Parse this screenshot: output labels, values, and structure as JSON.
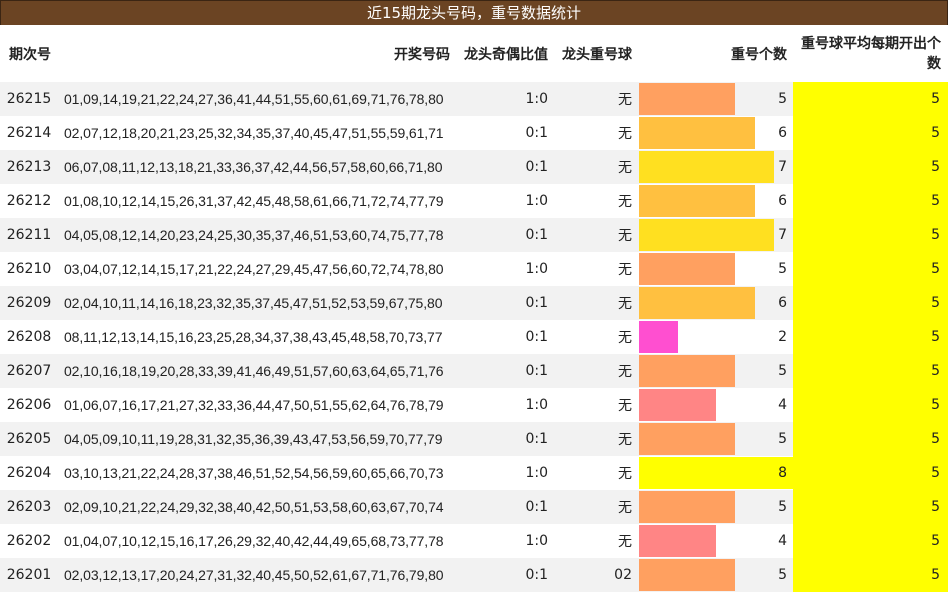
{
  "title": "近15期龙头号码，重号数据统计",
  "headers": {
    "issue": "期次号",
    "numbers": "开奖号码",
    "odd_even": "龙头奇偶比值",
    "repeat_ball": "龙头重号球",
    "repeat_count": "重号个数",
    "avg": "重号球平均每期开出个数"
  },
  "scale_max": 8,
  "colors": {
    "title_bg": "#6b4423",
    "avg_bg": "#ffff00",
    "count_2": "#ff4fd0",
    "count_4": "#ff8585",
    "count_5": "#ffa060",
    "count_6": "#ffc040",
    "count_7": "#ffe020",
    "count_8": "#ffff00"
  },
  "rows": [
    {
      "issue": "26215",
      "numbers": "01,09,14,19,21,22,24,27,36,41,44,51,55,60,61,69,71,76,78,80",
      "odd_even": "1:0",
      "repeat_ball": "无",
      "repeat_count": 5,
      "avg": "5"
    },
    {
      "issue": "26214",
      "numbers": "02,07,12,18,20,21,23,25,32,34,35,37,40,45,47,51,55,59,61,71",
      "odd_even": "0:1",
      "repeat_ball": "无",
      "repeat_count": 6,
      "avg": "5"
    },
    {
      "issue": "26213",
      "numbers": "06,07,08,11,12,13,18,21,33,36,37,42,44,56,57,58,60,66,71,80",
      "odd_even": "0:1",
      "repeat_ball": "无",
      "repeat_count": 7,
      "avg": "5"
    },
    {
      "issue": "26212",
      "numbers": "01,08,10,12,14,15,26,31,37,42,45,48,58,61,66,71,72,74,77,79",
      "odd_even": "1:0",
      "repeat_ball": "无",
      "repeat_count": 6,
      "avg": "5"
    },
    {
      "issue": "26211",
      "numbers": "04,05,08,12,14,20,23,24,25,30,35,37,46,51,53,60,74,75,77,78",
      "odd_even": "0:1",
      "repeat_ball": "无",
      "repeat_count": 7,
      "avg": "5"
    },
    {
      "issue": "26210",
      "numbers": "03,04,07,12,14,15,17,21,22,24,27,29,45,47,56,60,72,74,78,80",
      "odd_even": "1:0",
      "repeat_ball": "无",
      "repeat_count": 5,
      "avg": "5"
    },
    {
      "issue": "26209",
      "numbers": "02,04,10,11,14,16,18,23,32,35,37,45,47,51,52,53,59,67,75,80",
      "odd_even": "0:1",
      "repeat_ball": "无",
      "repeat_count": 6,
      "avg": "5"
    },
    {
      "issue": "26208",
      "numbers": "08,11,12,13,14,15,16,23,25,28,34,37,38,43,45,48,58,70,73,77",
      "odd_even": "0:1",
      "repeat_ball": "无",
      "repeat_count": 2,
      "avg": "5"
    },
    {
      "issue": "26207",
      "numbers": "02,10,16,18,19,20,28,33,39,41,46,49,51,57,60,63,64,65,71,76",
      "odd_even": "0:1",
      "repeat_ball": "无",
      "repeat_count": 5,
      "avg": "5"
    },
    {
      "issue": "26206",
      "numbers": "01,06,07,16,17,21,27,32,33,36,44,47,50,51,55,62,64,76,78,79",
      "odd_even": "1:0",
      "repeat_ball": "无",
      "repeat_count": 4,
      "avg": "5"
    },
    {
      "issue": "26205",
      "numbers": "04,05,09,10,11,19,28,31,32,35,36,39,43,47,53,56,59,70,77,79",
      "odd_even": "0:1",
      "repeat_ball": "无",
      "repeat_count": 5,
      "avg": "5"
    },
    {
      "issue": "26204",
      "numbers": "03,10,13,21,22,24,28,37,38,46,51,52,54,56,59,60,65,66,70,73",
      "odd_even": "1:0",
      "repeat_ball": "无",
      "repeat_count": 8,
      "avg": "5"
    },
    {
      "issue": "26203",
      "numbers": "02,09,10,21,22,24,29,32,38,40,42,50,51,53,58,60,63,67,70,74",
      "odd_even": "0:1",
      "repeat_ball": "无",
      "repeat_count": 5,
      "avg": "5"
    },
    {
      "issue": "26202",
      "numbers": "01,04,07,10,12,15,16,17,26,29,32,40,42,44,49,65,68,73,77,78",
      "odd_even": "1:0",
      "repeat_ball": "无",
      "repeat_count": 4,
      "avg": "5"
    },
    {
      "issue": "26201",
      "numbers": "02,03,12,13,17,20,24,27,31,32,40,45,50,52,61,67,71,76,79,80",
      "odd_even": "0:1",
      "repeat_ball": "02",
      "repeat_count": 5,
      "avg": "5"
    }
  ]
}
